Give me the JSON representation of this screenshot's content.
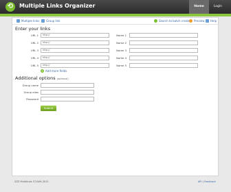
{
  "header": {
    "title": "Multiple Links Organizer",
    "nav": [
      {
        "label": "Home",
        "active": true
      },
      {
        "label": "Login",
        "active": false
      }
    ]
  },
  "subbar": {
    "left_tabs": [
      "Multiple links",
      "Group link"
    ],
    "right_tabs": [
      "Search to batch create",
      "Preview",
      "Help"
    ]
  },
  "links": {
    "heading": "Enter your links",
    "rows": [
      {
        "url_label": "URL 1",
        "url_value": "http://",
        "name_label": "Name 1",
        "name_value": ""
      },
      {
        "url_label": "URL 2",
        "url_value": "http://",
        "name_label": "Name 2",
        "name_value": ""
      },
      {
        "url_label": "URL 3",
        "url_value": "http://",
        "name_label": "Name 3",
        "name_value": ""
      },
      {
        "url_label": "URL 4",
        "url_value": "http://",
        "name_label": "Name 4",
        "name_value": ""
      },
      {
        "url_label": "URL 5",
        "url_value": "http://",
        "name_label": "Name 5",
        "name_value": ""
      }
    ],
    "add_more": "Add more fields"
  },
  "options": {
    "heading": "Additional options",
    "heading_note": "(optional)",
    "fields": [
      {
        "label": "Group name",
        "value": ""
      },
      {
        "label": "Group alias",
        "value": ""
      },
      {
        "label": "Password",
        "value": ""
      }
    ],
    "submit": "Submit"
  },
  "footer": {
    "left": "ZZZ Multilinks ©2009-2011",
    "right_links": [
      "API",
      "Feedback"
    ]
  },
  "colors": {
    "accent_green": "#8cc63f",
    "header_dark": "#2b2b2b",
    "link_blue": "#3b6aa8"
  }
}
